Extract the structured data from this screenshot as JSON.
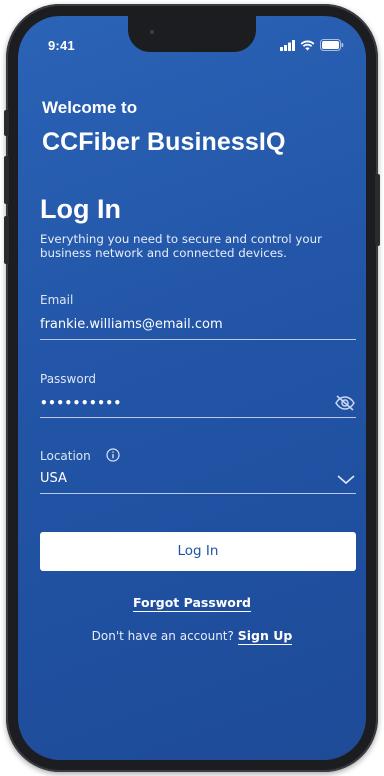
{
  "status_bar": {
    "time": "9:41"
  },
  "header": {
    "welcome": "Welcome to",
    "brand": "CCFiber BusinessIQ"
  },
  "login": {
    "heading": "Log In",
    "description": "Everything you need to secure and control your business network and connected devices."
  },
  "form": {
    "email": {
      "label": "Email",
      "value": "frankie.williams@email.com"
    },
    "password": {
      "label": "Password",
      "value": "••••••••••"
    },
    "location": {
      "label": "Location",
      "value": "USA"
    },
    "submit_label": "Log In",
    "forgot_label": "Forgot Password"
  },
  "signup": {
    "prompt": "Don't have an account?",
    "link": "Sign Up"
  },
  "icons": {
    "eye": "eye-slash-icon",
    "info": "info-icon",
    "chevron": "chevron-down-icon",
    "signal": "signal-icon",
    "wifi": "wifi-icon",
    "battery": "battery-icon"
  },
  "colors": {
    "background": "#2356a8",
    "button": "#ffffff",
    "button_text": "#1f52a3"
  }
}
